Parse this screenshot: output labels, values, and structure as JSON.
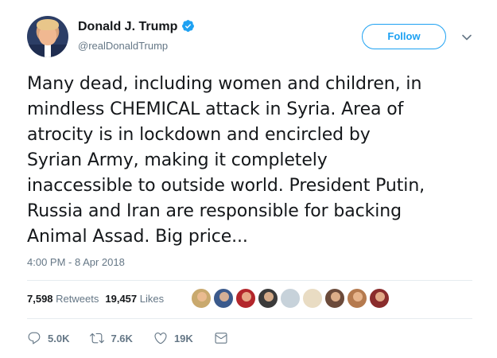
{
  "user": {
    "name": "Donald J. Trump",
    "handle": "@realDonaldTrump",
    "verified": true
  },
  "follow_button": {
    "label": "Follow"
  },
  "tweet": {
    "text": "Many dead, including women and children, in\nmindless CHEMICAL attack in Syria. Area of\natrocity is in lockdown and encircled by\nSyrian Army, making it completely\ninaccessible to outside world. President Putin,\nRussia and Iran are responsible for backing\nAnimal Assad. Big price...",
    "timestamp": "4:00 PM - 8 Apr 2018"
  },
  "stats": {
    "retweets_count": "7,598",
    "retweets_label": "Retweets",
    "likes_count": "19,457",
    "likes_label": "Likes"
  },
  "likers": [
    {
      "name": "liker-avatar-1",
      "color": "#c9a96e"
    },
    {
      "name": "liker-avatar-2",
      "color": "#3b5a8c"
    },
    {
      "name": "liker-avatar-3",
      "color": "#b3262b"
    },
    {
      "name": "liker-avatar-4",
      "color": "#3a3a3a"
    },
    {
      "name": "liker-avatar-5",
      "color": "#c7d2da"
    },
    {
      "name": "liker-avatar-6",
      "color": "#e9dcc3"
    },
    {
      "name": "liker-avatar-7",
      "color": "#6b4a3a"
    },
    {
      "name": "liker-avatar-8",
      "color": "#b57a4e"
    },
    {
      "name": "liker-avatar-9",
      "color": "#8a2c2c"
    }
  ],
  "actions": {
    "replies": "5.0K",
    "retweets": "7.6K",
    "likes": "19K"
  },
  "colors": {
    "accent": "#1da1f2",
    "text": "#14171a",
    "secondary": "#657786",
    "divider": "#e6ecf0"
  }
}
